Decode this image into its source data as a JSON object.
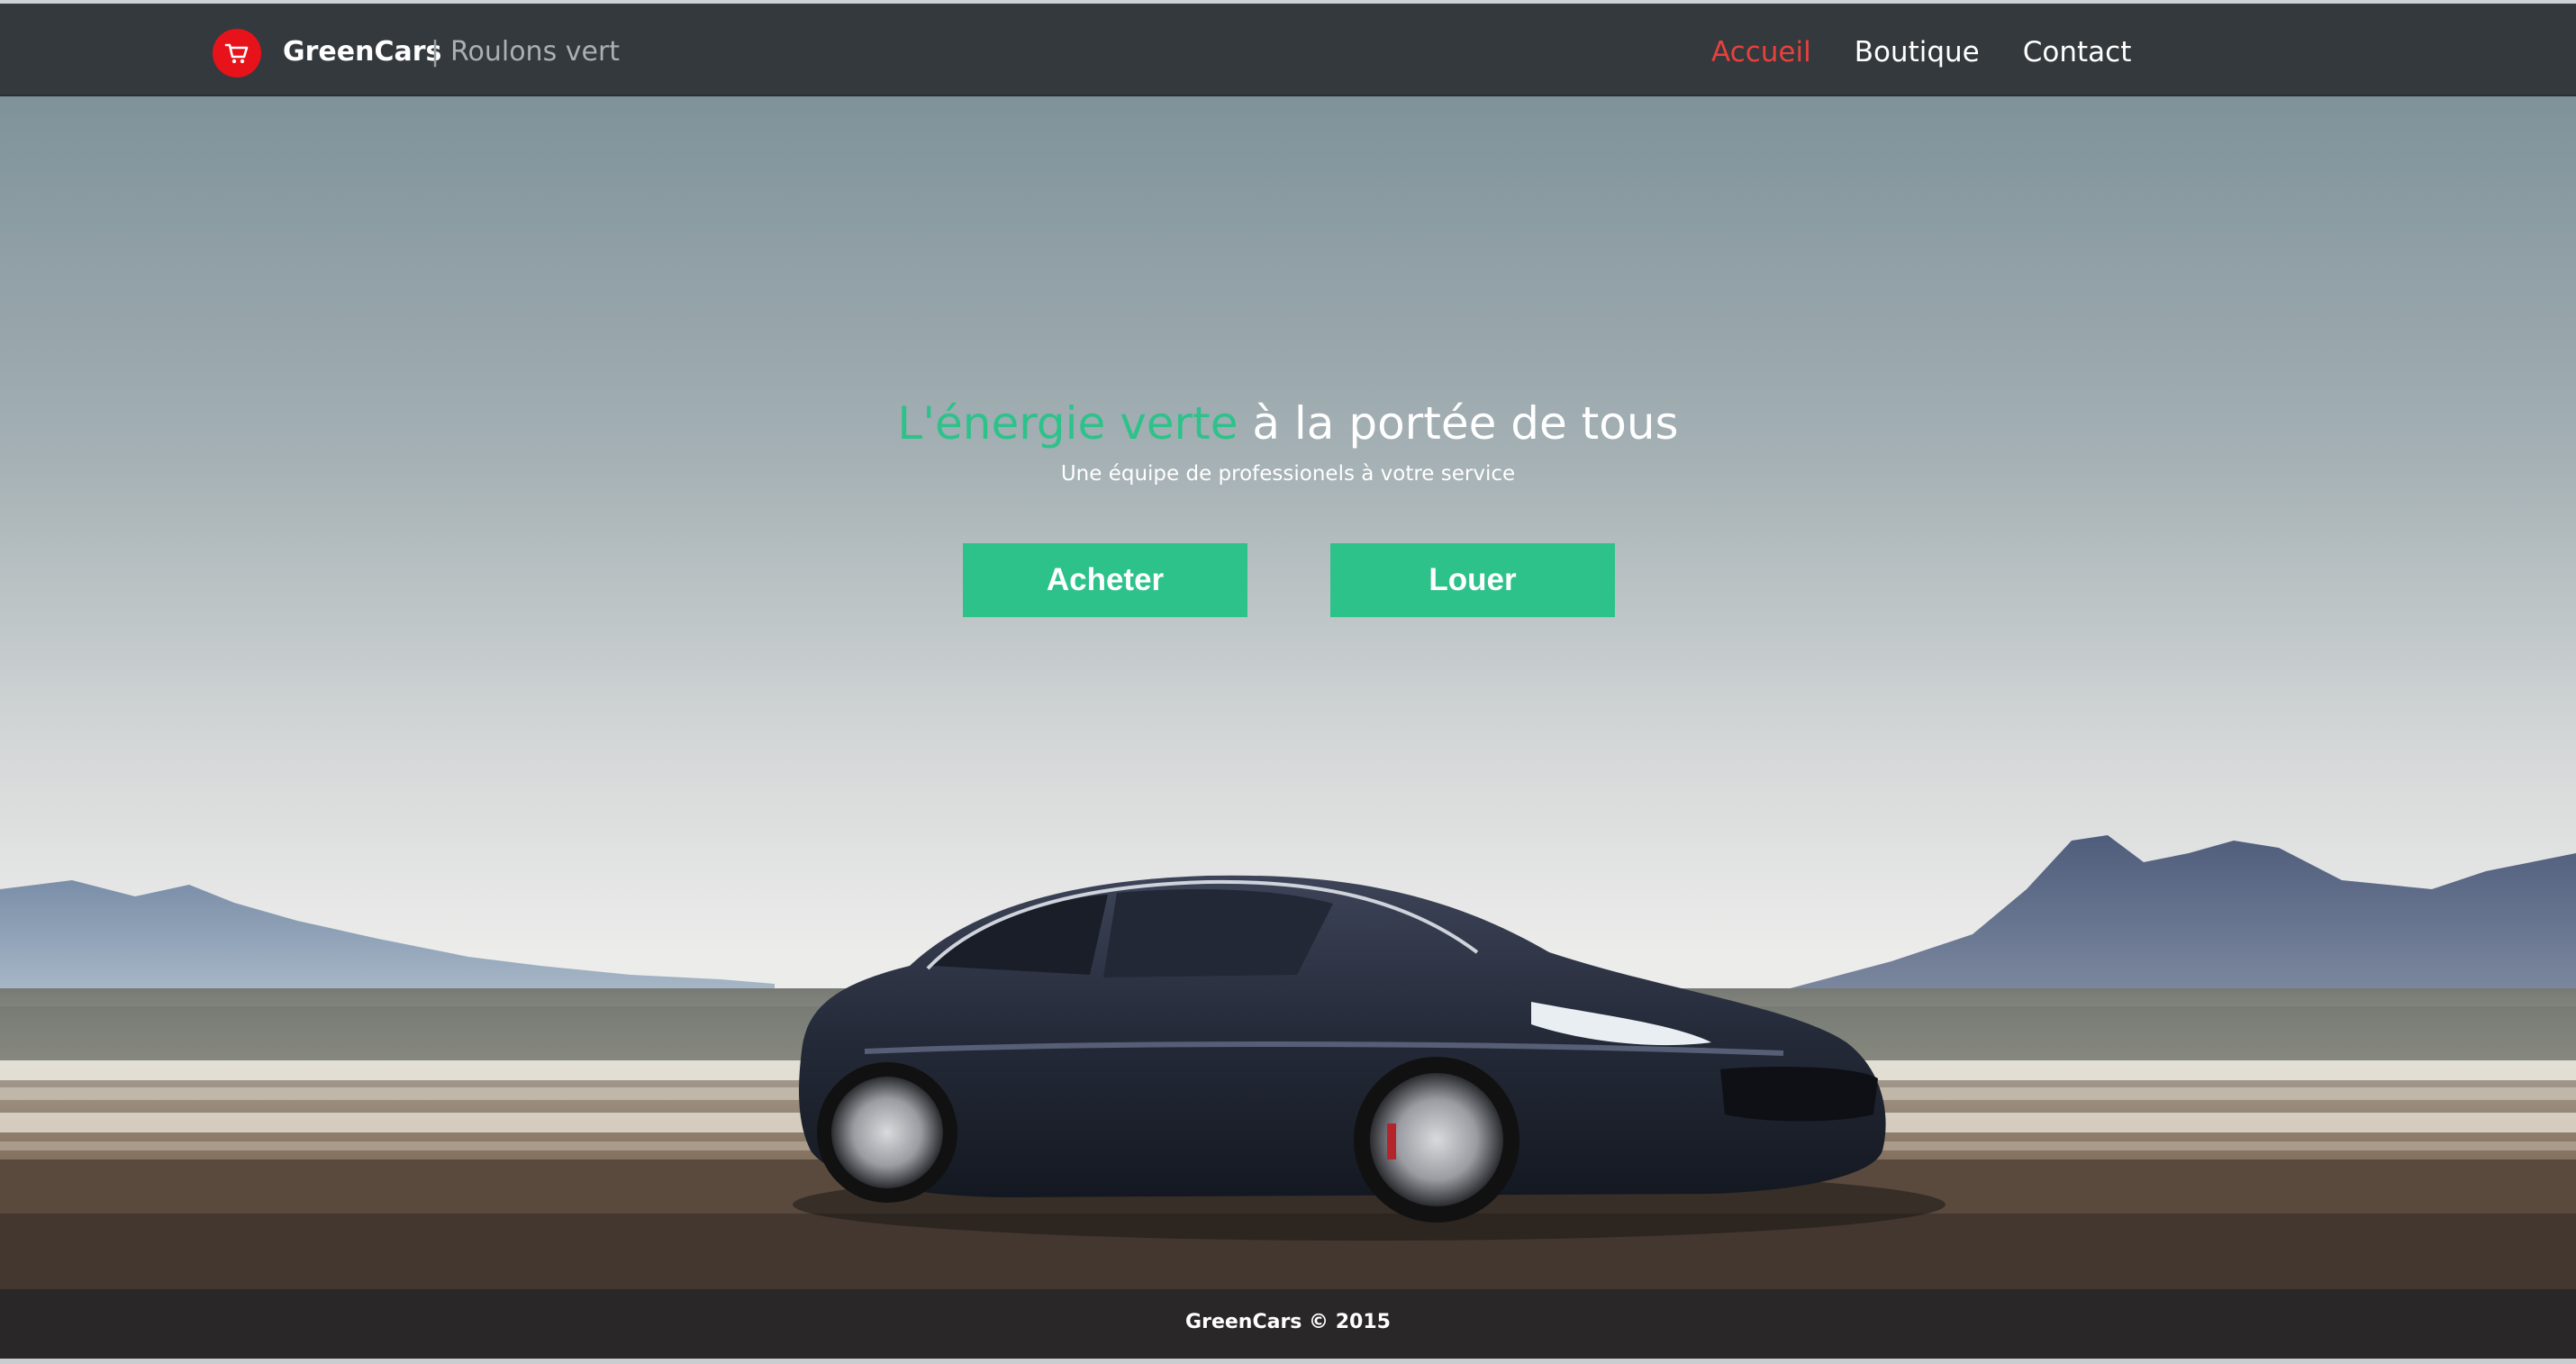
{
  "navbar": {
    "brand_name": "GreenCars",
    "brand_separator": "|",
    "brand_tagline": "Roulons vert",
    "logo_icon": "shopping-cart-icon",
    "links": [
      {
        "label": "Accueil",
        "active": true
      },
      {
        "label": "Boutique",
        "active": false
      },
      {
        "label": "Contact",
        "active": false
      }
    ]
  },
  "hero": {
    "title_accent": "L'énergie verte",
    "title_rest": " à la portée de tous",
    "subtitle": "Une équipe de professionels à votre service",
    "buttons": {
      "buy_label": "Acheter",
      "rent_label": "Louer"
    }
  },
  "footer": {
    "copyright": "GreenCars © 2015"
  },
  "colors": {
    "accent_green": "#2ec28b",
    "active_link_red": "#e8413c",
    "navbar_bg": "#33393d",
    "logo_red": "#e8131a"
  }
}
